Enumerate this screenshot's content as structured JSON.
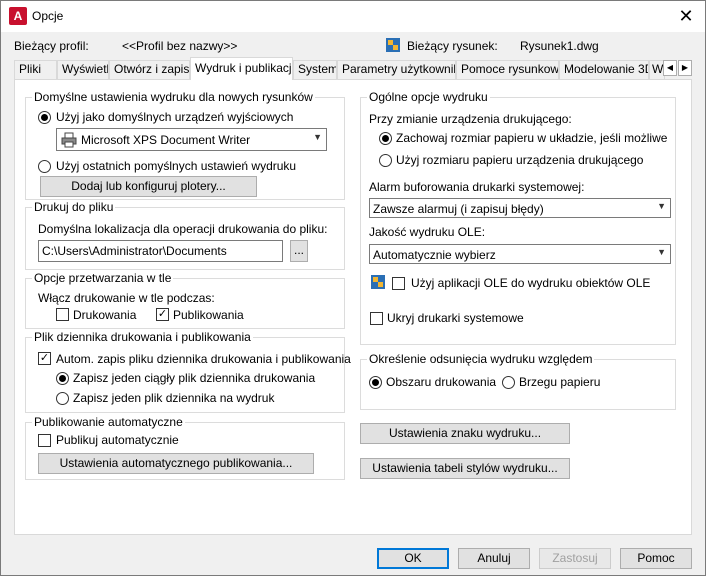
{
  "window": {
    "title": "Opcje",
    "app_icon_letter": "A"
  },
  "header": {
    "profile_label": "Bieżący profil:",
    "profile_value": "<<Profil bez nazwy>>",
    "drawing_label": "Bieżący rysunek:",
    "drawing_value": "Rysunek1.dwg"
  },
  "tabs": [
    "Pliki",
    "Wyświetl",
    "Otwórz i zapisz",
    "Wydruk i publikacja",
    "System",
    "Parametry użytkownika",
    "Pomoce rysunkowe",
    "Modelowanie 3D",
    "W"
  ],
  "active_tab": "Wydruk i publikacja",
  "default_output": {
    "title": "Domyślne ustawienia wydruku dla nowych rysunków",
    "use_default_device_label": "Użyj jako domyślnych urządzeń wyjściowych",
    "device_value": "Microsoft XPS Document Writer",
    "use_last_label": "Użyj ostatnich pomyślnych ustawień wydruku",
    "add_plotters_button": "Dodaj lub konfiguruj plotery..."
  },
  "plot_to_file": {
    "title": "Drukuj do pliku",
    "location_label": "Domyślna lokalizacja dla operacji drukowania do pliku:",
    "location_value": "C:\\Users\\Administrator\\Documents",
    "browse_button": "..."
  },
  "background": {
    "title": "Opcje przetwarzania w tle",
    "enable_label": "Włącz drukowanie w tle podczas:",
    "plotting_label": "Drukowania",
    "plotting_checked": false,
    "publishing_label": "Publikowania",
    "publishing_checked": true
  },
  "log": {
    "title": "Plik dziennika drukowania i publikowania",
    "auto_save_label": "Autom. zapis pliku dziennika drukowania i publikowania",
    "auto_save_checked": true,
    "continuous_label": "Zapisz jeden ciągły plik dziennika drukowania",
    "per_plot_label": "Zapisz jeden plik dziennika na wydruk"
  },
  "auto_publish": {
    "title": "Publikowanie automatyczne",
    "auto_label": "Publikuj automatycznie",
    "auto_checked": false,
    "settings_button": "Ustawienia automatycznego publikowania..."
  },
  "general": {
    "title": "Ogólne opcje wydruku",
    "when_changing_label": "Przy zmianie urządzenia drukującego:",
    "keep_paper_label": "Zachowaj rozmiar papieru w układzie, jeśli możliwe",
    "use_device_paper_label": "Użyj rozmiaru papieru urządzenia drukującego",
    "spool_alert_label": "Alarm buforowania drukarki systemowej:",
    "spool_alert_value": "Zawsze alarmuj (i zapisuj błędy)",
    "ole_quality_label": "Jakość wydruku OLE:",
    "ole_quality_value": "Automatycznie wybierz",
    "use_ole_app_label": "Użyj aplikacji OLE do wydruku obiektów OLE",
    "use_ole_app_checked": false,
    "hide_system_printers_label": "Ukryj drukarki systemowe",
    "hide_system_printers_checked": false
  },
  "offset": {
    "title": "Określenie odsunięcia wydruku względem",
    "printable_area_label": "Obszaru drukowania",
    "paper_edge_label": "Brzegu papieru"
  },
  "right_buttons": {
    "stamp": "Ustawienia znaku wydruku...",
    "style_table": "Ustawienia tabeli stylów wydruku..."
  },
  "footer": {
    "ok": "OK",
    "cancel": "Anuluj",
    "apply": "Zastosuj",
    "help": "Pomoc"
  },
  "colors": {
    "accent": "#0078d7",
    "app_red": "#c8102e"
  }
}
